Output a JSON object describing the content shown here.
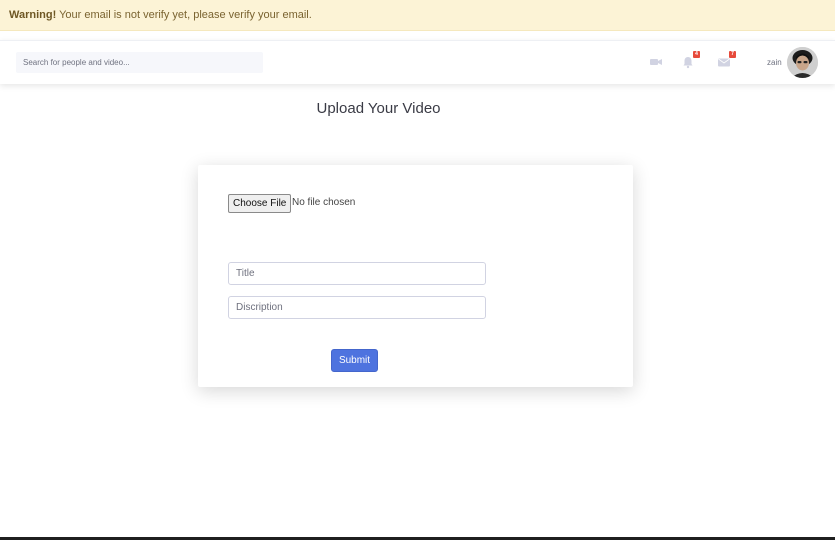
{
  "alert": {
    "strong": "Warning!",
    "message": " Your email is not verify yet, please verify your email."
  },
  "navbar": {
    "search_placeholder": "Search for people and video...",
    "icons": {
      "video": "video-camera-icon",
      "notifications": "bell-icon",
      "messages": "envelope-icon"
    },
    "notifications_count": "4",
    "messages_count": "7",
    "user_name": "zain"
  },
  "page": {
    "title": "Upload Your Video"
  },
  "form": {
    "choose_file_label": "Choose File",
    "file_status": "No file chosen",
    "title_placeholder": "Title",
    "description_placeholder": "Discription",
    "submit_label": "Submit"
  },
  "colors": {
    "alert_bg": "#fcf3d6",
    "primary": "#4e73df",
    "badge": "#e74a3b"
  }
}
